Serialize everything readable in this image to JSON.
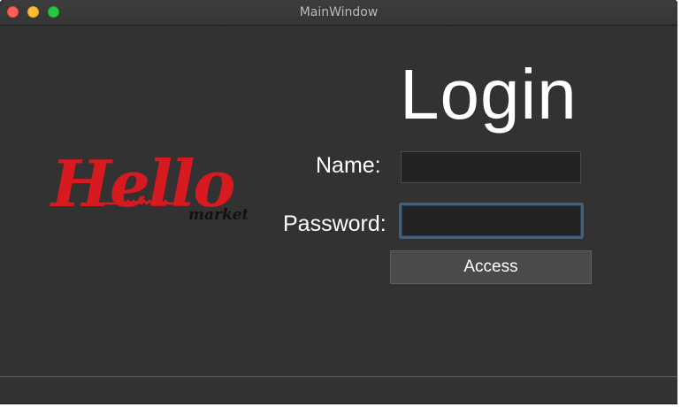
{
  "window": {
    "title": "MainWindow"
  },
  "logo": {
    "brand": "Hello",
    "subtitle": "market",
    "colors": {
      "brand": "#d71920",
      "subtitle": "#111111"
    }
  },
  "login": {
    "heading": "Login",
    "name_label": "Name:",
    "password_label": "Password:",
    "name_value": "",
    "password_value": "",
    "access_button": "Access"
  },
  "colors": {
    "window_bg": "#323232",
    "text": "#ffffff",
    "input_bg": "#232323",
    "focus_ring": "#44607a",
    "button_bg": "#4a4a4a"
  },
  "icons": {
    "close": "close-window-icon",
    "minimize": "minimize-window-icon",
    "zoom": "zoom-window-icon"
  }
}
